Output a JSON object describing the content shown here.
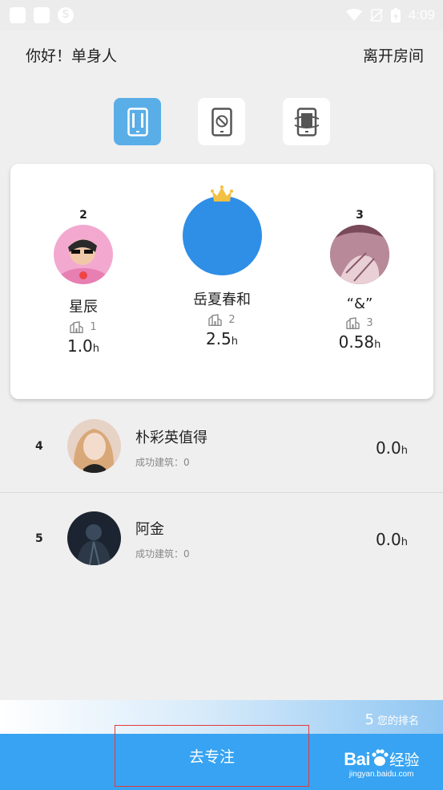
{
  "status_bar": {
    "time": "4:09",
    "s_icon": "S"
  },
  "header": {
    "greeting": "你好！单身人",
    "leave_button": "离开房间"
  },
  "modes": [
    "phone-focus-icon",
    "no-phone-icon",
    "phone-rotate-icon"
  ],
  "podium": {
    "first": {
      "rank": "",
      "name": "岳夏春和",
      "buildings": "2",
      "hours": "2.5",
      "unit": "h"
    },
    "second": {
      "rank": "2",
      "name": "星辰",
      "buildings": "1",
      "hours": "1.0",
      "unit": "h"
    },
    "third": {
      "rank": "3",
      "name": "“&”",
      "buildings": "3",
      "hours": "0.58",
      "unit": "h"
    }
  },
  "list": [
    {
      "rank": "4",
      "name": "朴彩英值得",
      "sub": "成功建筑：0",
      "hours": "0.0",
      "unit": "h"
    },
    {
      "rank": "5",
      "name": "阿金",
      "sub": "成功建筑：0",
      "hours": "0.0",
      "unit": "h"
    }
  ],
  "my_rank": {
    "number": "5",
    "label": "您的排名"
  },
  "bottom": {
    "focus_button": "去专注"
  },
  "watermark": {
    "logo": "Bai",
    "logo2": "经验",
    "url": "jingyan.baidu.com"
  },
  "colors": {
    "accent": "#37a3f2",
    "active_mode": "#5aaee8",
    "first_avatar": "#2f8ee6",
    "crown": "#f4c042"
  }
}
